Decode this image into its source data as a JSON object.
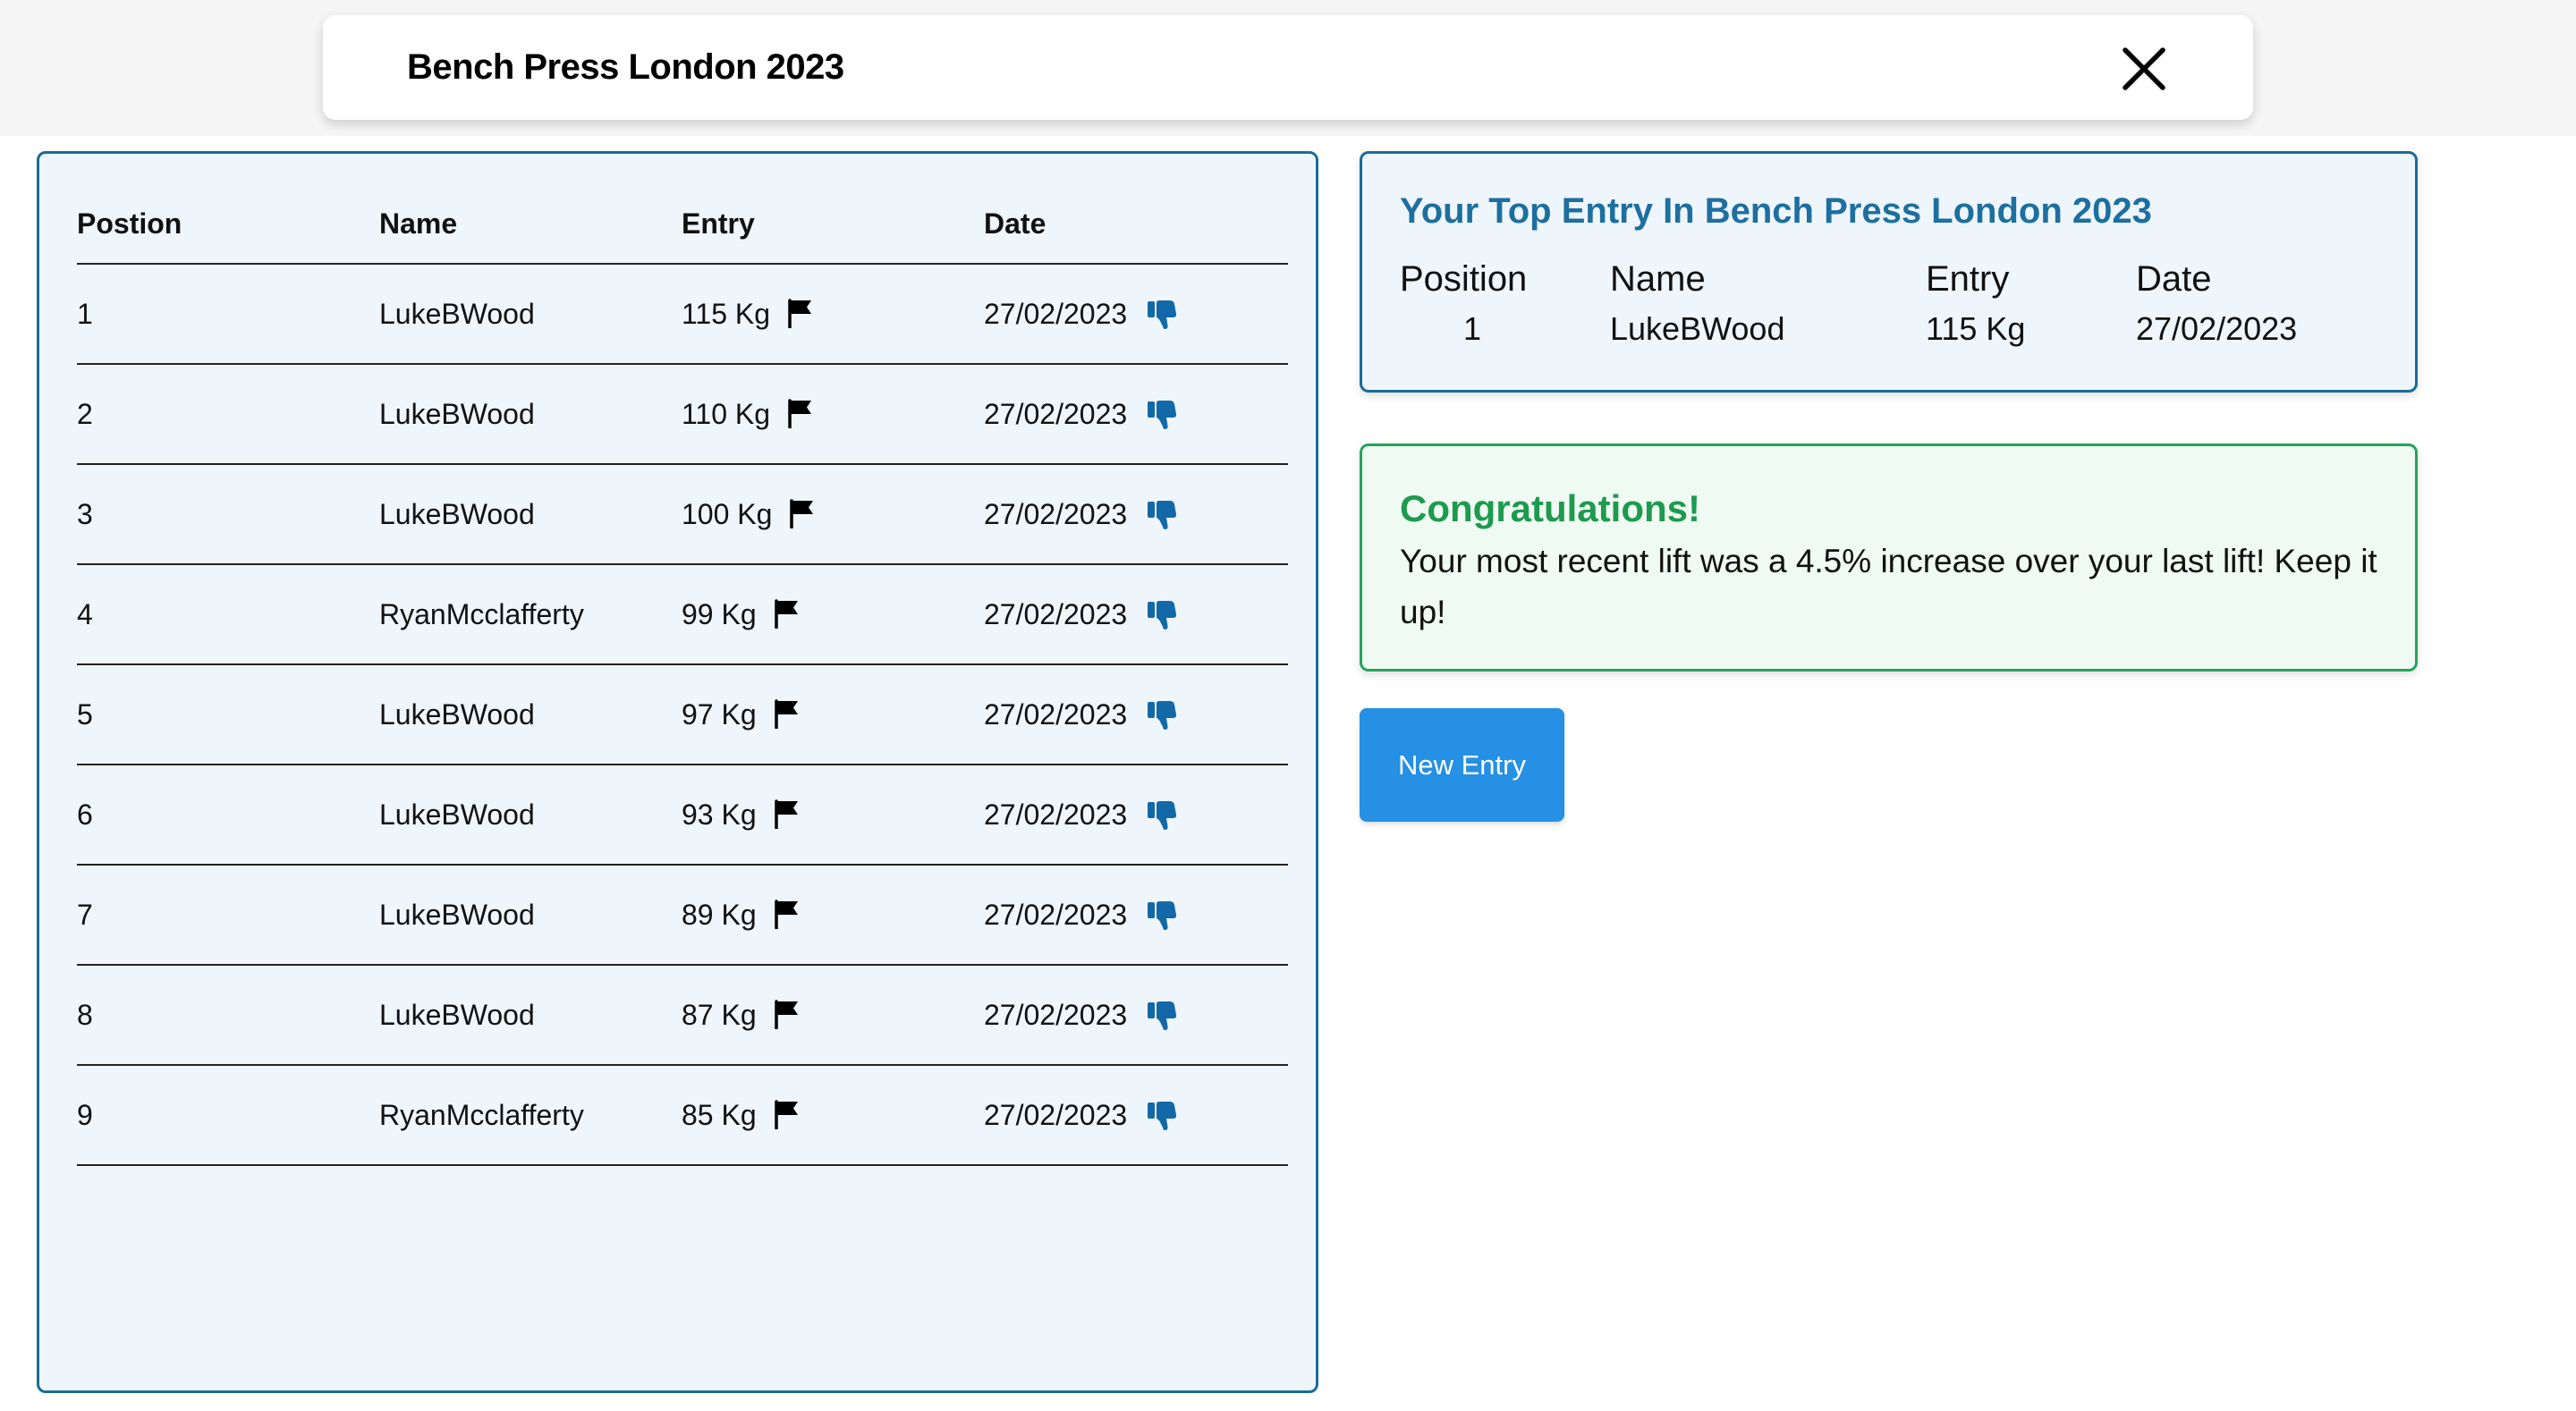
{
  "header": {
    "title": "Bench Press London 2023",
    "close_icon": "close-icon"
  },
  "leaderboard": {
    "columns": [
      "Postion",
      "Name",
      "Entry",
      "Date"
    ],
    "rows": [
      {
        "position": "1",
        "name": "LukeBWood",
        "entry": "115 Kg",
        "date": "27/02/2023"
      },
      {
        "position": "2",
        "name": "LukeBWood",
        "entry": "110 Kg",
        "date": "27/02/2023"
      },
      {
        "position": "3",
        "name": "LukeBWood",
        "entry": "100 Kg",
        "date": "27/02/2023"
      },
      {
        "position": "4",
        "name": "RyanMcclafferty",
        "entry": "99 Kg",
        "date": "27/02/2023"
      },
      {
        "position": "5",
        "name": "LukeBWood",
        "entry": "97 Kg",
        "date": "27/02/2023"
      },
      {
        "position": "6",
        "name": "LukeBWood",
        "entry": "93 Kg",
        "date": "27/02/2023"
      },
      {
        "position": "7",
        "name": "LukeBWood",
        "entry": "89 Kg",
        "date": "27/02/2023"
      },
      {
        "position": "8",
        "name": "LukeBWood",
        "entry": "87 Kg",
        "date": "27/02/2023"
      },
      {
        "position": "9",
        "name": "RyanMcclafferty",
        "entry": "85 Kg",
        "date": "27/02/2023"
      }
    ],
    "row_icons": {
      "entry": "flag-icon",
      "date": "thumbs-down-icon"
    }
  },
  "top_entry": {
    "title": "Your Top Entry In Bench Press London 2023",
    "labels": {
      "position": "Position",
      "name": "Name",
      "entry": "Entry",
      "date": "Date"
    },
    "values": {
      "position": "1",
      "name": "LukeBWood",
      "entry": "115 Kg",
      "date": "27/02/2023"
    }
  },
  "congrats": {
    "title": "Congratulations!",
    "message": "Your most recent lift was a 4.5% increase over your last lift! Keep it up!"
  },
  "actions": {
    "new_entry_label": "New Entry"
  },
  "colors": {
    "panel_border": "#1a6b99",
    "panel_bg": "#eef6fc",
    "title_blue": "#1d6fa0",
    "thumb_icon": "#1369a8",
    "success_green": "#1e9a4f",
    "success_border": "#28a35a",
    "success_bg": "#eefaf2",
    "button_blue": "#2590e4"
  }
}
